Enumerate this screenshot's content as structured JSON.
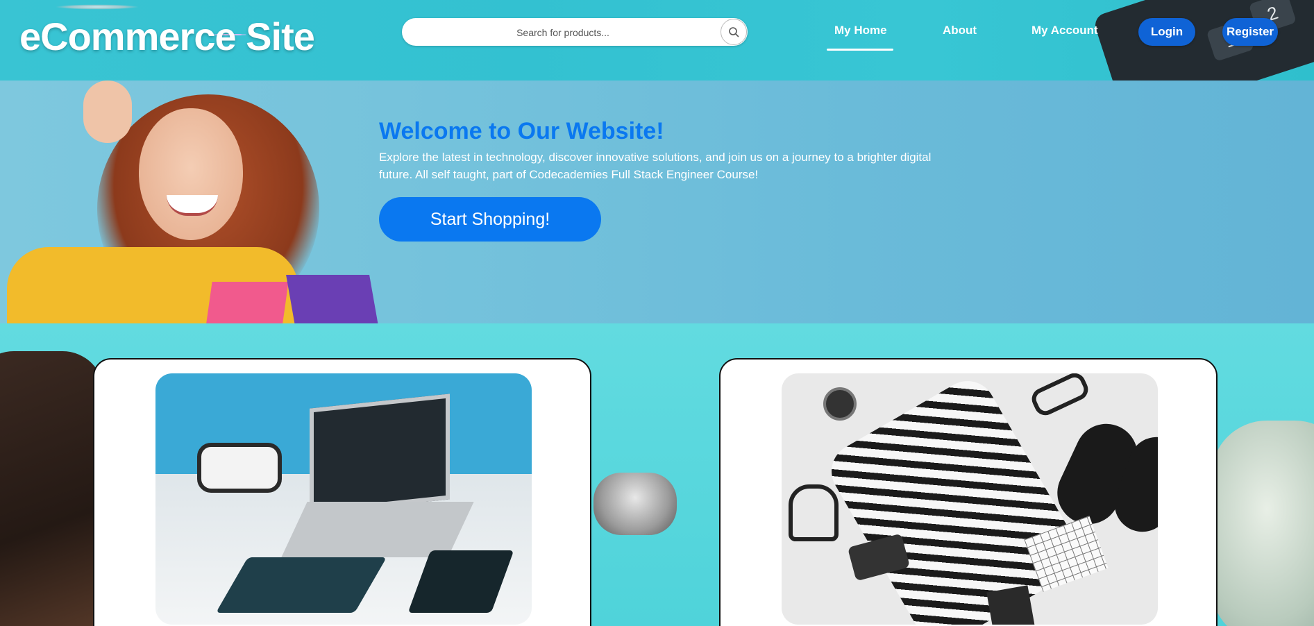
{
  "header": {
    "logo": "eCommerce Site",
    "search": {
      "placeholder": "Search for products...",
      "icon": "search-icon"
    },
    "nav": [
      {
        "label": "My Home",
        "active": true
      },
      {
        "label": "About",
        "active": false
      },
      {
        "label": "My Account",
        "active": false
      }
    ],
    "login_label": "Login",
    "register_label": "Register",
    "calculator_keys": [
      "1",
      "2"
    ]
  },
  "hero": {
    "title": "Welcome to Our Website!",
    "text": "Explore the latest in technology, discover innovative solutions, and join us on a journey to a brighter digital future. All self taught, part of Codecademies Full Stack Engineer Course!",
    "cta_label": "Start Shopping!"
  },
  "colors": {
    "accent": "#0a78f0",
    "button": "#0f63d6",
    "hero_bg": "#6abbd9",
    "page_bg": "#4fd3da"
  },
  "products": [
    {
      "name": "tech-product-card",
      "image": "laptop-and-gadgets-image"
    },
    {
      "name": "fashion-product-card",
      "image": "fashion-flatlay-image"
    }
  ]
}
